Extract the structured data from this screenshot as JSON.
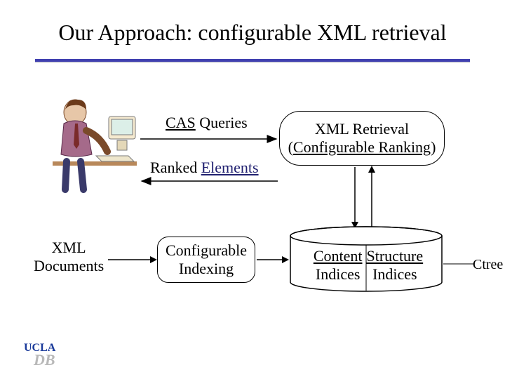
{
  "title": "Our Approach: configurable XML retrieval",
  "labels": {
    "cas_text": "CAS",
    "queries_text": " Queries",
    "ranked_text": "Ranked ",
    "elements_text": "Elements",
    "xml_docs_line1": "XML",
    "xml_docs_line2": "Documents",
    "ctree": "Ctree"
  },
  "boxes": {
    "retrieval_line1": "XML Retrieval",
    "retrieval_line2a": "(",
    "retrieval_line2b": "Configurable Ranking",
    "retrieval_line2c": ")",
    "indexing_line1": "Configurable",
    "indexing_line2": "Indexing"
  },
  "db": {
    "content_word": "Content",
    "structure_word": "Structure",
    "indices_word": "Indices"
  },
  "logo": {
    "text": "UCLA",
    "sub": "DB"
  }
}
